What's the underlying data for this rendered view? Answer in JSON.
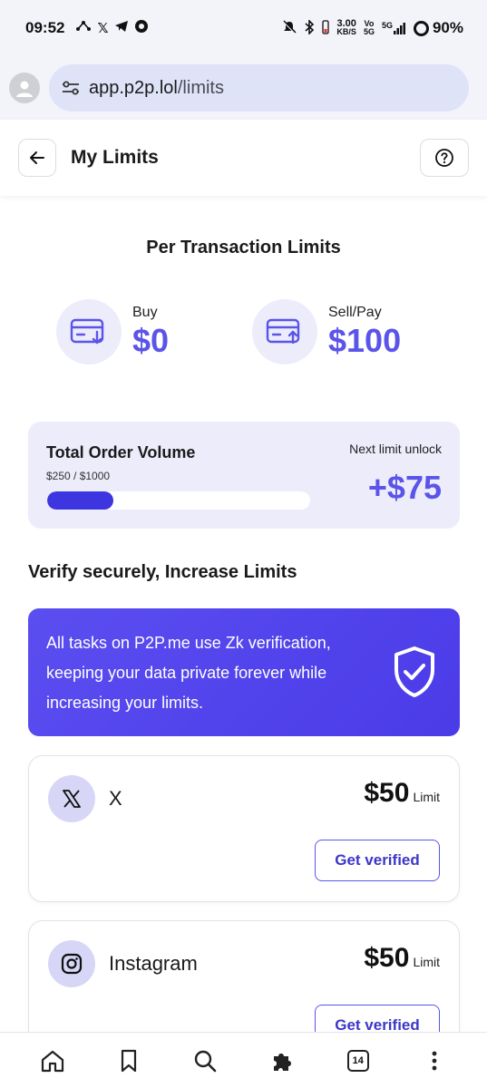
{
  "status_bar": {
    "time": "09:52",
    "net_speed_top": "3.00",
    "net_speed_bottom": "KB/S",
    "vo_top": "Vo",
    "vo_bottom": "5G",
    "signal_label": "5G",
    "battery": "90%"
  },
  "browser": {
    "url_domain": "app.p2p.lol",
    "url_path": "/limits"
  },
  "header": {
    "title": "My Limits"
  },
  "per_transaction": {
    "heading": "Per Transaction Limits",
    "buy_label": "Buy",
    "buy_amount": "$0",
    "sell_label": "Sell/Pay",
    "sell_amount": "$100"
  },
  "order_volume": {
    "title": "Total Order Volume",
    "progress_text": "$250 / $1000",
    "progress_fraction": 0.25,
    "unlock_label": "Next limit unlock",
    "unlock_amount": "+$75"
  },
  "verify": {
    "heading": "Verify securely, Increase Limits",
    "banner_text": "All tasks on P2P.me use Zk verification, keeping your data private forever while increasing your limits."
  },
  "tasks": [
    {
      "name": "X",
      "limit_value": "$50",
      "limit_unit": "Limit",
      "button": "Get verified"
    },
    {
      "name": "Instagram",
      "limit_value": "$50",
      "limit_unit": "Limit",
      "button": "Get verified"
    }
  ],
  "bottom_nav": {
    "tab_count": "14"
  },
  "colors": {
    "accent": "#5b54e8",
    "accent_dark": "#3d36e0",
    "card_bg": "#ececfb"
  }
}
